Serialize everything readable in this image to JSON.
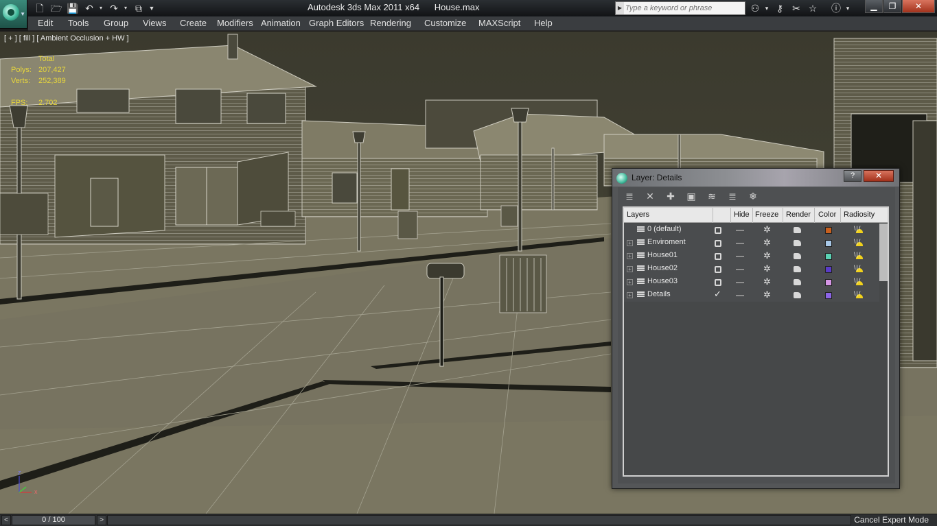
{
  "window": {
    "title": "Autodesk 3ds Max  2011 x64",
    "filename": "House.max",
    "search_placeholder": "Type a keyword or phrase",
    "controls": [
      "minimize",
      "maximize",
      "close"
    ]
  },
  "menu": [
    "Edit",
    "Tools",
    "Group",
    "Views",
    "Create",
    "Modifiers",
    "Animation",
    "Graph Editors",
    "Rendering",
    "Customize",
    "MAXScript",
    "Help"
  ],
  "viewport": {
    "label": "[ + ] [ fill ] [ Ambient Occlusion + HW ]",
    "stats": {
      "header": "Total",
      "polys_label": "Polys:",
      "polys": "207,427",
      "verts_label": "Verts:",
      "verts": "252,389",
      "fps_label": "FPS:",
      "fps": "2.702"
    },
    "axis": {
      "x": "x",
      "z": "z"
    }
  },
  "timeline": {
    "value": "0 / 100",
    "prev": "<",
    "next": ">"
  },
  "status": {
    "cancel_expert": "Cancel Expert Mode"
  },
  "layer_dialog": {
    "title": "Layer: Details",
    "help": "?",
    "close": "✕",
    "columns": [
      "Layers",
      "Hide",
      "Freeze",
      "Render",
      "Color",
      "Radiosity"
    ],
    "layers": [
      {
        "name": "0 (default)",
        "expandable": false,
        "current": false,
        "color": "#c8601e"
      },
      {
        "name": "Enviroment",
        "expandable": true,
        "current": false,
        "color": "#a8c8e8"
      },
      {
        "name": "House01",
        "expandable": true,
        "current": false,
        "color": "#5ad2b4"
      },
      {
        "name": "House02",
        "expandable": true,
        "current": false,
        "color": "#5a3cc8"
      },
      {
        "name": "House03",
        "expandable": true,
        "current": false,
        "color": "#d696e6"
      },
      {
        "name": "Details",
        "expandable": true,
        "current": true,
        "color": "#8c64e6"
      }
    ]
  },
  "colors": {
    "viewport_bg": "#76725d",
    "wire": "#c8c6bc",
    "stats": "#e8d73b",
    "dialog_bg": "#545658"
  }
}
